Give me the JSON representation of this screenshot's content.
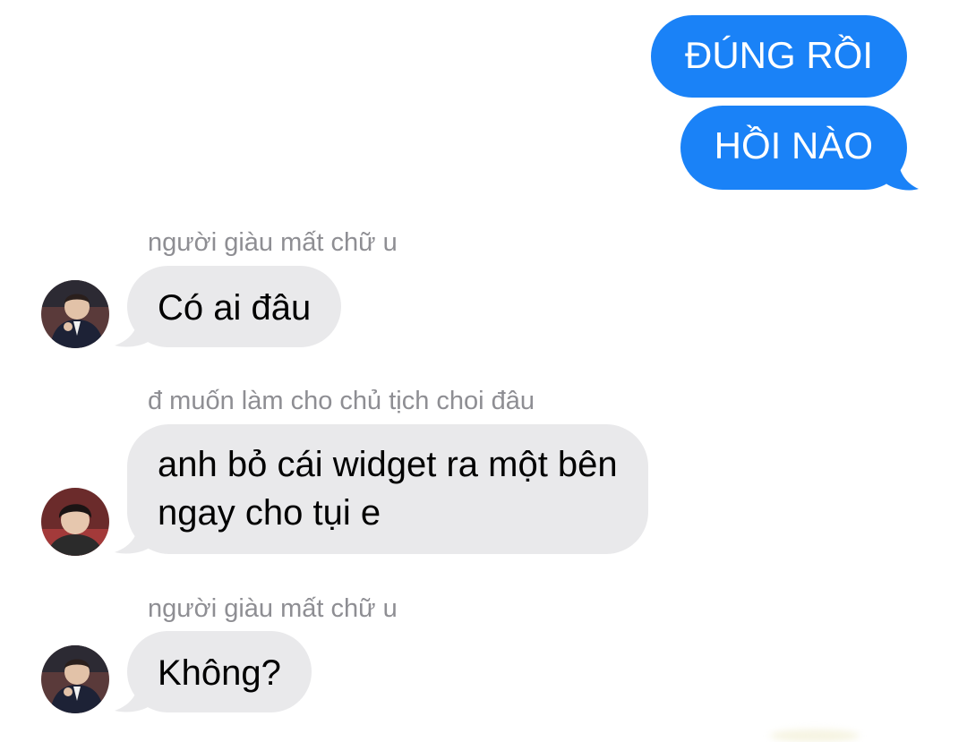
{
  "conversation": {
    "outgoing": [
      {
        "text": "ĐÚNG RỒI"
      },
      {
        "text": "HỒI NÀO"
      }
    ],
    "incoming": [
      {
        "sender": "người giàu mất chữ u",
        "avatar_icon": "person-avatar-icon",
        "lines": [
          "Có ai đâu"
        ]
      },
      {
        "sender": "đ muốn làm cho chủ tịch choi đâu",
        "avatar_icon": "person-avatar-icon",
        "lines": [
          "anh bỏ cái widget ra một bên",
          "ngay cho tụi e"
        ]
      },
      {
        "sender": "người giàu mất chữ u",
        "avatar_icon": "person-avatar-icon",
        "lines": [
          "Không?"
        ]
      }
    ]
  },
  "colors": {
    "outgoing_bubble": "#1a82f7",
    "incoming_bubble": "#e9e9eb",
    "sender_name": "#8e8e93",
    "background": "#ffffff"
  }
}
